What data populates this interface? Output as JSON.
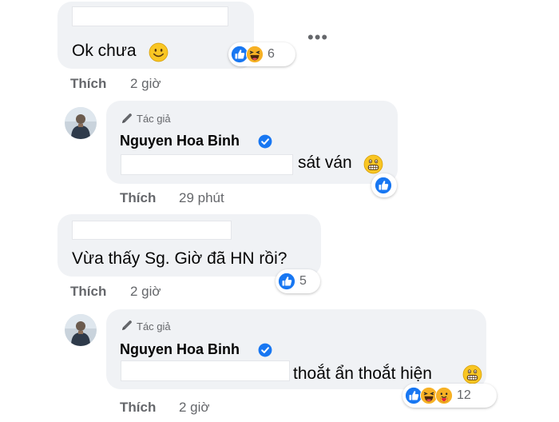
{
  "colors": {
    "bubble": "#f0f2f5",
    "secondary_text": "#65676b",
    "like_blue": "#1877f2",
    "emoji_yellow": "#f7b125",
    "love_red": "#e41e3f"
  },
  "comments": [
    {
      "text": "Ok chưa",
      "emoji": "smile-emoji",
      "reaction_count": "6",
      "reaction_icons": [
        "like-icon",
        "haha-icon"
      ],
      "actions": {
        "like_label": "Thích",
        "time": "2 giờ"
      },
      "reply": {
        "author_tag": "Tác giả",
        "author_name": "Nguyen Hoa Binh",
        "text": "sát ván",
        "emoji": "grimace-emoji",
        "reaction_icons": [
          "like-icon"
        ],
        "actions": {
          "like_label": "Thích",
          "time": "29 phút"
        }
      }
    },
    {
      "text": "Vừa thấy Sg. Giờ đã HN rồi?",
      "reaction_count": "5",
      "reaction_icons": [
        "like-icon"
      ],
      "actions": {
        "like_label": "Thích",
        "time": "2 giờ"
      },
      "reply": {
        "author_tag": "Tác giả",
        "author_name": "Nguyen Hoa Binh",
        "text": "thoắt ẩn thoắt hiện",
        "emoji": "grimace-emoji",
        "reaction_count": "12",
        "reaction_icons": [
          "like-icon",
          "haha-icon",
          "care-icon"
        ],
        "actions": {
          "like_label": "Thích",
          "time": "2 giờ"
        }
      }
    }
  ],
  "more_options_icon": "more-horizontal-icon"
}
